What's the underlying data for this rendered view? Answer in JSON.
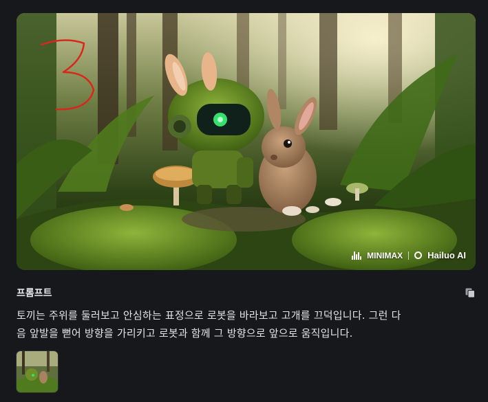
{
  "media": {
    "annotation": "3",
    "watermark": {
      "brand1": "MINIMAX",
      "brand2": "Hailuo AI"
    }
  },
  "prompt": {
    "label": "프롬프트",
    "line1": "토끼는 주위를 둘러보고 안심하는 표정으로 로봇을 바라보고 고개를 끄덕입니다. 그런 다",
    "line2": "음 앞발을 뻗어 방향을 가리키고 로봇과 함께 그 방향으로 앞으로 움직입니다.",
    "copy_icon": "copy-icon"
  },
  "colors": {
    "background": "#17181c",
    "annotation": "#d8271c",
    "moss": "#5f8a1e",
    "robot_eye": "#36e06c"
  }
}
